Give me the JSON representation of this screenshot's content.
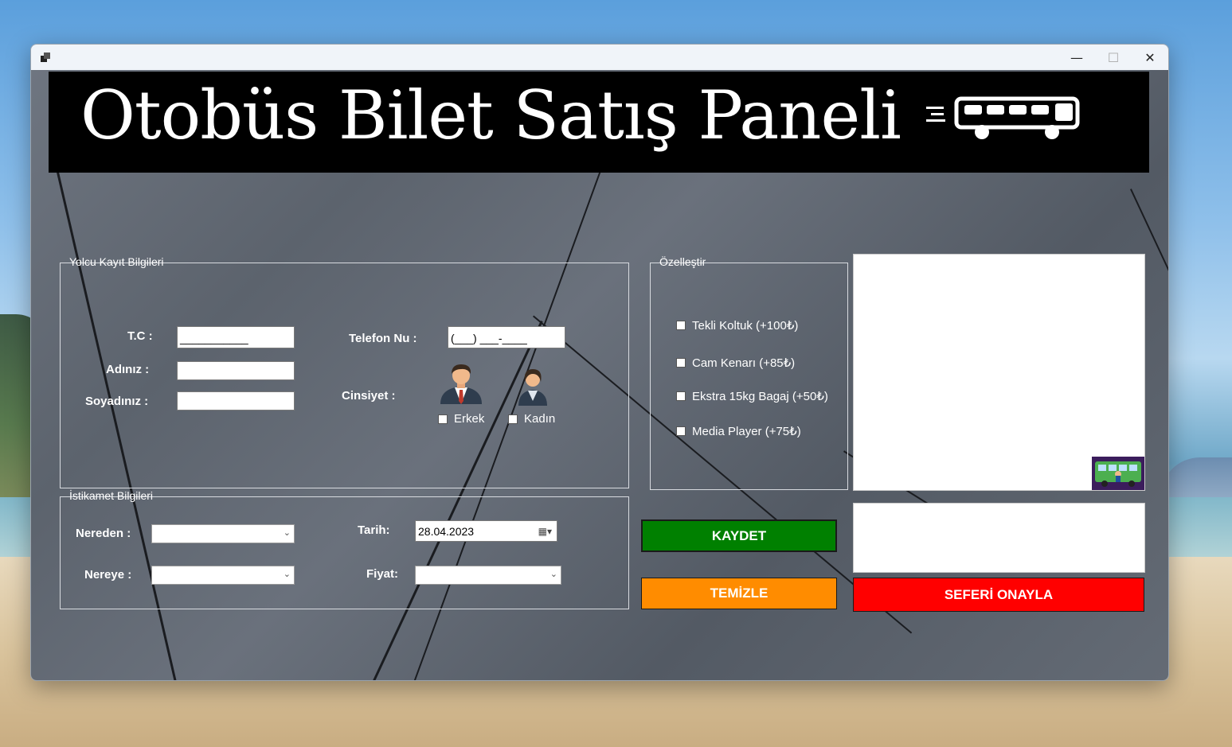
{
  "window": {
    "title_icon": "app-icon",
    "controls": {
      "minimize": "—",
      "maximize": "☐",
      "close": "✕"
    }
  },
  "banner": {
    "title": "Otobüs Bilet Satış Paneli",
    "icon": "bus-icon"
  },
  "passenger": {
    "group_title": "Yolcu Kayıt Bilgileri",
    "tc_label": "T.C :",
    "tc_value": "___________",
    "name_label": "Adınız :",
    "name_value": "",
    "surname_label": "Soyadınız :",
    "surname_value": "",
    "phone_label": "Telefon Nu :",
    "phone_value": "(___) ___-____",
    "gender_label": "Cinsiyet :",
    "male_label": "Erkek",
    "female_label": "Kadın"
  },
  "destination": {
    "group_title": "İstikamet Bilgileri",
    "from_label": "Nereden :",
    "to_label": "Nereye :",
    "date_label": "Tarih:",
    "date_value": "28.04.2023",
    "price_label": "Fiyat:"
  },
  "customize": {
    "group_title": "Özelleştir",
    "options": [
      {
        "label": "Tekli Koltuk (+100₺)"
      },
      {
        "label": "Cam Kenarı (+85₺)"
      },
      {
        "label": "Ekstra 15kg Bagaj (+50₺)"
      },
      {
        "label": "Media Player (+75₺)"
      }
    ]
  },
  "buttons": {
    "save": "KAYDET",
    "clear": "TEMİZLE",
    "confirm": "SEFERİ ONAYLA"
  },
  "colors": {
    "save": "#008000",
    "clear": "#ff8c00",
    "confirm": "#ff0000"
  }
}
